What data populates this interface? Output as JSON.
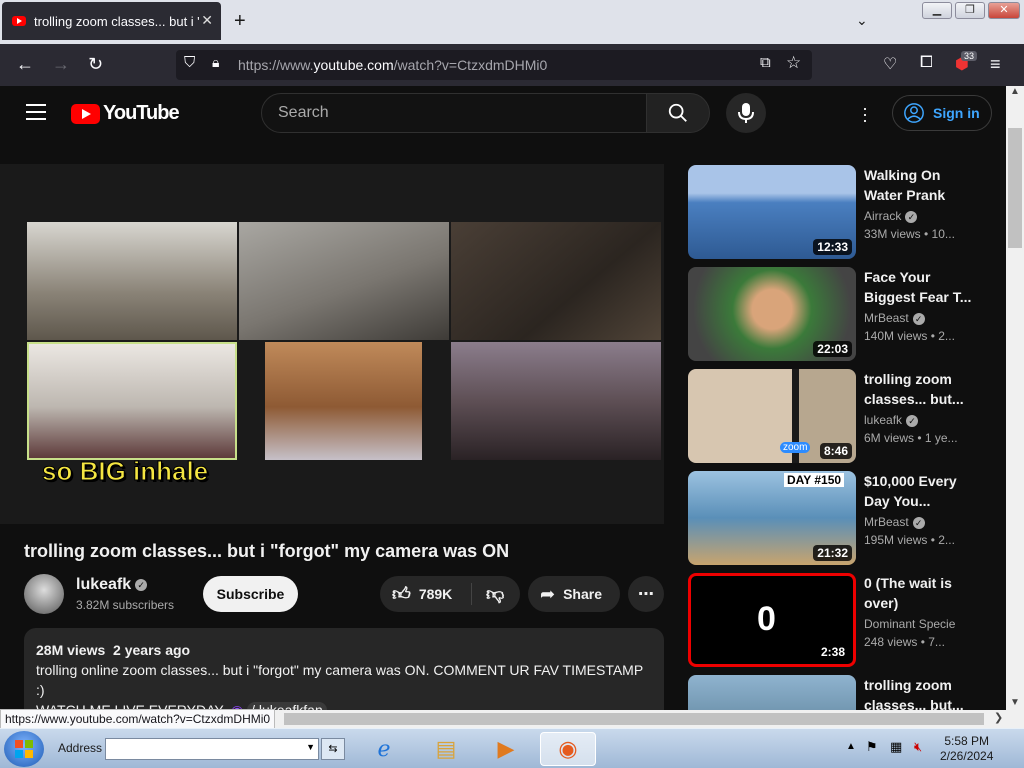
{
  "browser": {
    "tab_title": "trolling zoom classes... but i \"fo",
    "url_prefix": "https://www.",
    "url_domain": "youtube.com",
    "url_path": "/watch?v=CtzxdmDHMi0",
    "extension_badge": "33",
    "status_url": "https://www.youtube.com/watch?v=CtzxdmDHMi0"
  },
  "youtube": {
    "logo_text": "YouTube",
    "search_placeholder": "Search",
    "sign_in": "Sign in",
    "video": {
      "caption_overlay": "so BIG inhale",
      "title": "trolling zoom classes... but i \"forgot\" my camera was ON",
      "channel": "lukeafk",
      "subscribers": "3.82M subscribers",
      "subscribe_label": "Subscribe",
      "likes": "789K",
      "share_label": "Share",
      "views": "28M views",
      "age": "2 years ago",
      "description_line1": "trolling online zoom classes... but i \"forgot\" my camera was ON. COMMENT UR FAV TIMESTAMP :)",
      "description_line2_prefix": "WATCH ME LIVE EVERYDAY-",
      "description_link": "/ lukeafkfan"
    },
    "sidebar": [
      {
        "title1": "Walking On",
        "title2": "Water Prank",
        "channel": "Airrack",
        "meta": "33M views  • 10...",
        "duration": "12:33",
        "color": "#4a7fc0"
      },
      {
        "title1": "Face Your",
        "title2": "Biggest Fear T...",
        "channel": "MrBeast",
        "meta": "140M views  • 2...",
        "duration": "22:03",
        "color": "#3b7a3a"
      },
      {
        "title1": "trolling zoom",
        "title2": "classes... but...",
        "channel": "lukeafk",
        "meta": "6M views  • 1 ye...",
        "duration": "8:46",
        "color": "#b7a78f"
      },
      {
        "title1": "$10,000 Every",
        "title2": "Day You...",
        "channel": "MrBeast",
        "meta": "195M views  • 2...",
        "duration": "21:32",
        "color": "#5a8fb8"
      },
      {
        "title1": "0 (The wait is",
        "title2": "over)",
        "channel": "Dominant Specie",
        "meta": "248 views  • 7...",
        "duration": "2:38",
        "color": "#000000"
      },
      {
        "title1": "trolling zoom",
        "title2": "classes... but...",
        "channel": "",
        "meta": "",
        "duration": "",
        "color": "#6a8fa8"
      }
    ],
    "thumb_text": {
      "day": "DAY #150",
      "zero": "0",
      "zoom": "zoom"
    }
  },
  "taskbar": {
    "address_label": "Address",
    "time": "5:58 PM",
    "date": "2/26/2024"
  }
}
